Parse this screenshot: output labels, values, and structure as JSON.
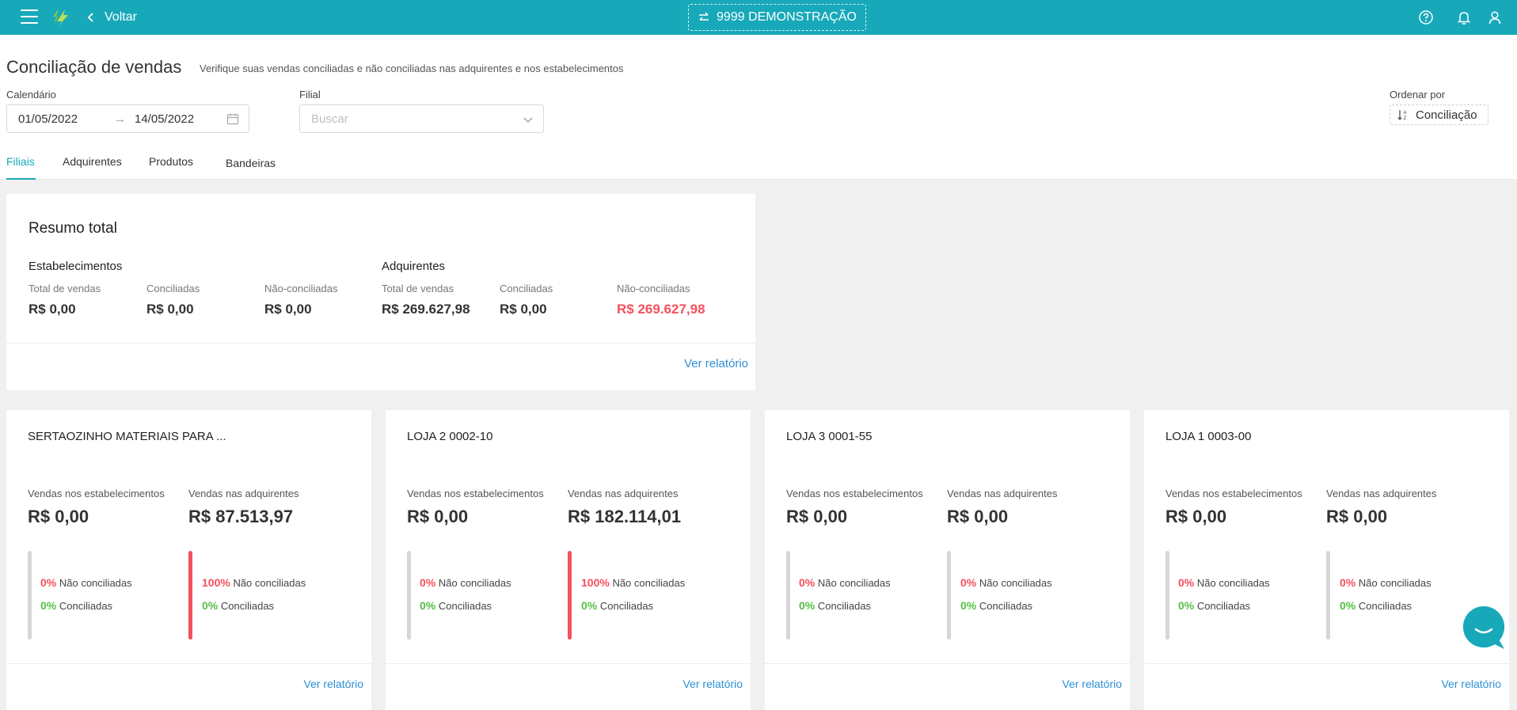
{
  "topbar": {
    "back_label": "Voltar",
    "company_label": "9999 DEMONSTRAÇÃO",
    "icons": [
      "menu-icon",
      "logo",
      "chevron-left-icon",
      "swap-icon",
      "help-icon",
      "bell-icon",
      "user-icon"
    ]
  },
  "page": {
    "title": "Conciliação de vendas",
    "subtitle": "Verifique suas vendas conciliadas e não conciliadas nas adquirentes e nos estabelecimentos"
  },
  "filters": {
    "calendar_label": "Calendário",
    "date_start": "01/05/2022",
    "date_end": "14/05/2022",
    "branch_label": "Filial",
    "branch_placeholder": "Buscar",
    "order_label": "Ordenar por",
    "order_value": "Conciliação"
  },
  "tabs": [
    {
      "label": "Filiais",
      "active": true
    },
    {
      "label": "Adquirentes",
      "active": false
    },
    {
      "label": "Produtos",
      "active": false
    },
    {
      "label": "Bandeiras",
      "active": false
    }
  ],
  "summary": {
    "title": "Resumo total",
    "establishments": {
      "title": "Estabelecimentos",
      "total_label": "Total de vendas",
      "total_value": "R$ 0,00",
      "reconciled_label": "Conciliadas",
      "reconciled_value": "R$ 0,00",
      "unreconciled_label": "Não-conciliadas",
      "unreconciled_value": "R$ 0,00"
    },
    "acquirers": {
      "title": "Adquirentes",
      "total_label": "Total de vendas",
      "total_value": "R$ 269.627,98",
      "reconciled_label": "Conciliadas",
      "reconciled_value": "R$ 0,00",
      "unreconciled_label": "Não-conciliadas",
      "unreconciled_value": "R$ 269.627,98"
    },
    "report_link": "Ver relatório"
  },
  "branch_labels": {
    "establishments": "Vendas nos estabelecimentos",
    "acquirers": "Vendas nas adquirentes",
    "not_reconciled": "Não conciliadas",
    "reconciled": "Conciliadas",
    "report_link": "Ver relatório"
  },
  "branches": [
    {
      "name": "SERTAOZINHO MATERIAIS PARA ...",
      "est_value": "R$ 0,00",
      "acq_value": "R$ 87.513,97",
      "est_not": "0%",
      "est_ok": "0%",
      "acq_not": "100%",
      "acq_ok": "0%"
    },
    {
      "name": "LOJA 2 0002-10",
      "est_value": "R$ 0,00",
      "acq_value": "R$ 182.114,01",
      "est_not": "0%",
      "est_ok": "0%",
      "acq_not": "100%",
      "acq_ok": "0%"
    },
    {
      "name": "LOJA 3 0001-55",
      "est_value": "R$ 0,00",
      "acq_value": "R$ 0,00",
      "est_not": "0%",
      "est_ok": "0%",
      "acq_not": "0%",
      "acq_ok": "0%"
    },
    {
      "name": "LOJA 1 0003-00",
      "est_value": "R$ 0,00",
      "acq_value": "R$ 0,00",
      "est_not": "0%",
      "est_ok": "0%",
      "acq_not": "0%",
      "acq_ok": "0%"
    }
  ],
  "colors": {
    "primary": "#17a9b9",
    "danger": "#f5505c",
    "success": "#55c045",
    "link": "#2d8fd5"
  }
}
